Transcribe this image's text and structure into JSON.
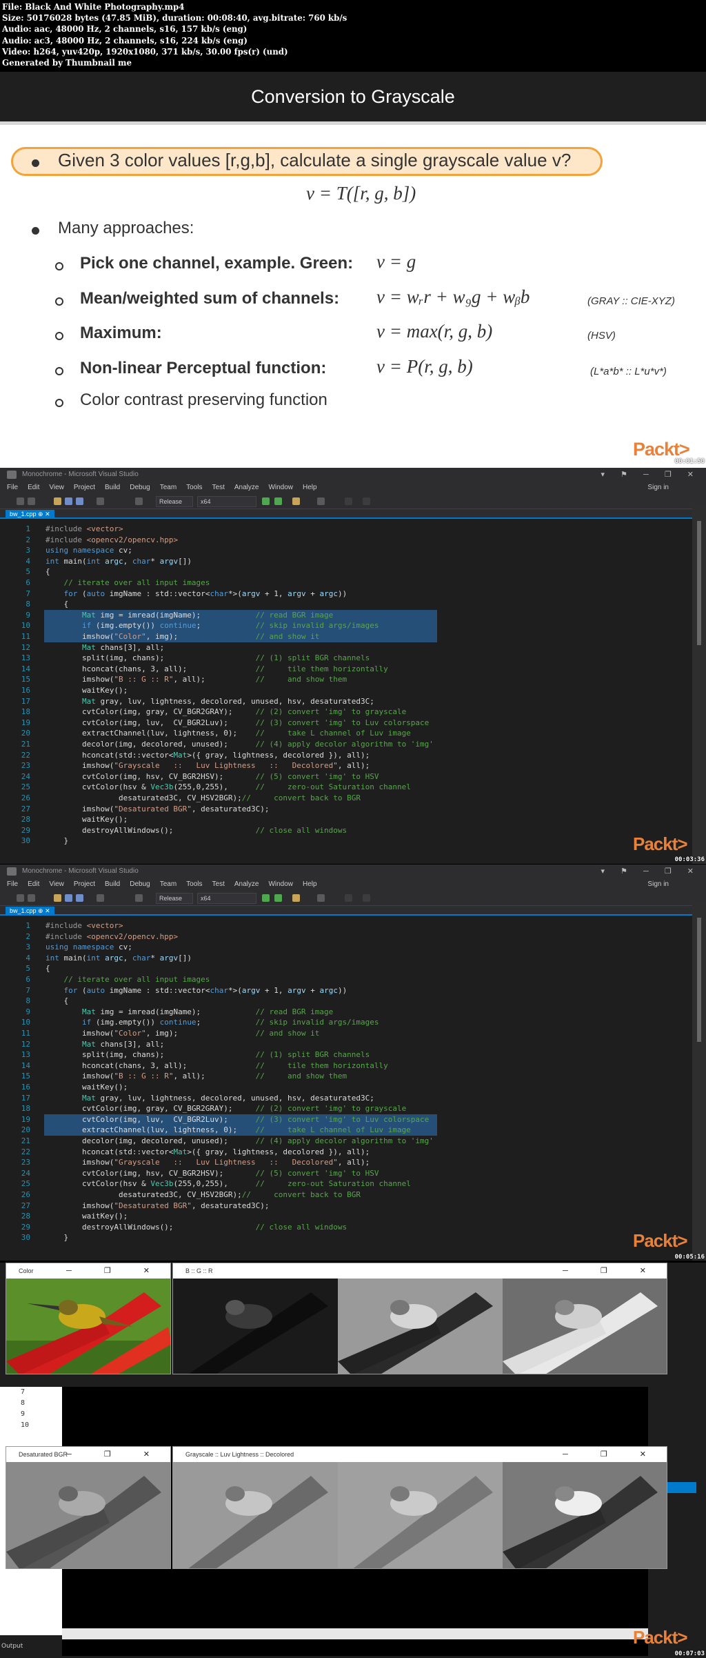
{
  "meta": {
    "file": "File: Black And White Photography.mp4",
    "size": "Size: 50176028 bytes (47.85 MiB), duration: 00:08:40, avg.bitrate: 760 kb/s",
    "audio1": "Audio: aac, 48000 Hz, 2 channels, s16, 157 kb/s (eng)",
    "audio2": "Audio: ac3, 48000 Hz, 2 channels, s16, 224 kb/s (eng)",
    "video": "Video: h264, yuv420p, 1920x1080, 371 kb/s, 30.00 fps(r) (und)",
    "generated": "Generated by Thumbnail me"
  },
  "timestamps": {
    "t1": "00:01:50",
    "t2": "00:03:36",
    "t3": "00:05:16",
    "t4": "00:07:03"
  },
  "slide": {
    "title": "Conversion to Grayscale",
    "bullet1": "Given 3 color values [r,g,b], calculate a single grayscale value v?",
    "formula1": "v  =  T([r, g, b])",
    "bullet2": "Many approaches:",
    "items": [
      {
        "label": "Pick one channel, example. Green:",
        "formula": "v  =  g",
        "note": ""
      },
      {
        "label": "Mean/weighted sum of channels:",
        "formula": "v = wᵣr + w₉g + wᵦb",
        "note": "(GRAY :: CIE-XYZ)"
      },
      {
        "label": "Maximum:",
        "formula": "v  = max(r, g, b)",
        "note": "(HSV)"
      },
      {
        "label": "Non-linear Perceptual function:",
        "formula": "v  =  P(r, g, b)",
        "note": "(L*a*b* :: L*u*v*)"
      },
      {
        "label": "Color contrast preserving function",
        "formula": "",
        "note": ""
      }
    ],
    "logo": "Packt>"
  },
  "vs": {
    "title": "Monochrome - Microsoft Visual Studio",
    "menu": [
      "File",
      "Edit",
      "View",
      "Project",
      "Build",
      "Debug",
      "Team",
      "Tools",
      "Test",
      "Analyze",
      "Window",
      "Help"
    ],
    "signin": "Sign in",
    "config": "Release",
    "platform": "x64",
    "tab": "bw_1.cpp"
  },
  "code": [
    "#include <vector>",
    "#include <opencv2/opencv.hpp>",
    "using namespace cv;",
    "int main(int argc, char* argv[])",
    "{",
    "    // iterate over all input images",
    "    for (auto imgName : std::vector<char*>(argv + 1, argv + argc))",
    "    {",
    "        Mat img = imread(imgName);            // read BGR image",
    "        if (img.empty()) continue;            // skip invalid args/images",
    "        imshow(\"Color\", img);                 // and show it",
    "        Mat chans[3], all;",
    "        split(img, chans);                    // (1) split BGR channels",
    "        hconcat(chans, 3, all);               //     tile them horizontally",
    "        imshow(\"B :: G :: R\", all);           //     and show them",
    "        waitKey();",
    "        Mat gray, luv, lightness, decolored, unused, hsv, desaturated3C;",
    "        cvtColor(img, gray, CV_BGR2GRAY);     // (2) convert 'img' to grayscale",
    "        cvtColor(img, luv,  CV_BGR2Luv);      // (3) convert 'img' to Luv colorspace",
    "        extractChannel(luv, lightness, 0);    //     take L channel of Luv image",
    "        decolor(img, decolored, unused);      // (4) apply decolor algorithm to 'img'",
    "        hconcat(std::vector<Mat>({ gray, lightness, decolored }), all);",
    "        imshow(\"Grayscale   ::   Luv Lightness   ::   Decolored\", all);",
    "        cvtColor(img, hsv, CV_BGR2HSV);       // (5) convert 'img' to HSV",
    "        cvtColor(hsv & Vec3b(255,0,255),      //     zero-out Saturation channel",
    "                desaturated3C, CV_HSV2BGR);//     convert back to BGR",
    "        imshow(\"Desaturated BGR\", desaturated3C);",
    "        waitKey();",
    "        destroyAllWindows();                  // close all windows",
    "    }"
  ],
  "images": {
    "color_title": "Color",
    "bgr_title": "B :: G :: R",
    "desat_title": "Desaturated BGR",
    "gray_title": "Grayscale   ::   Luv Lightness   ::   Decolored",
    "output_label": "Output",
    "line_nums": [
      "7",
      "8",
      "9",
      "10"
    ]
  }
}
